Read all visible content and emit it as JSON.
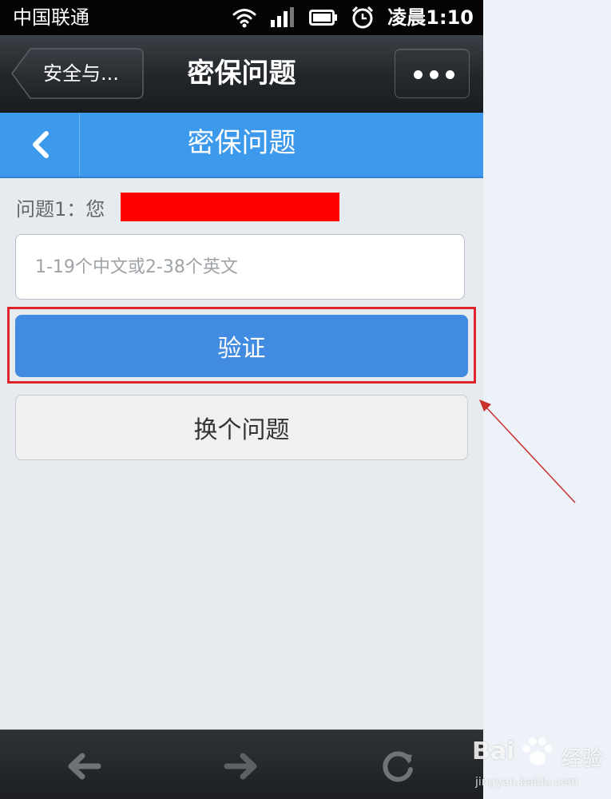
{
  "status_bar": {
    "carrier": "中国联通",
    "time": "凌晨1:10",
    "icons": [
      "wifi-icon",
      "signal-icon",
      "battery-icon",
      "alarm-icon"
    ]
  },
  "app_bar": {
    "back_label": "安全与...",
    "title": "密保问题",
    "more_icon": "more-dots-icon"
  },
  "page_header": {
    "back_icon": "chevron-left-icon",
    "title": "密保问题",
    "color": "#3d99eb"
  },
  "form": {
    "question_label": "问题1：您",
    "answer_placeholder": "1-19个中文或2-38个英文",
    "answer_value": "",
    "verify_label": "验证",
    "verify_color": "#418be0",
    "switch_label": "换个问题"
  },
  "bottom_nav": {
    "icons": [
      "arrow-back-icon",
      "arrow-forward-icon",
      "refresh-icon"
    ]
  },
  "annotation": {
    "highlight_color": "#e1252c"
  },
  "watermark": {
    "brand": "Bai",
    "brand_suffix": "经验",
    "url": "jingyan.baidu.com"
  }
}
